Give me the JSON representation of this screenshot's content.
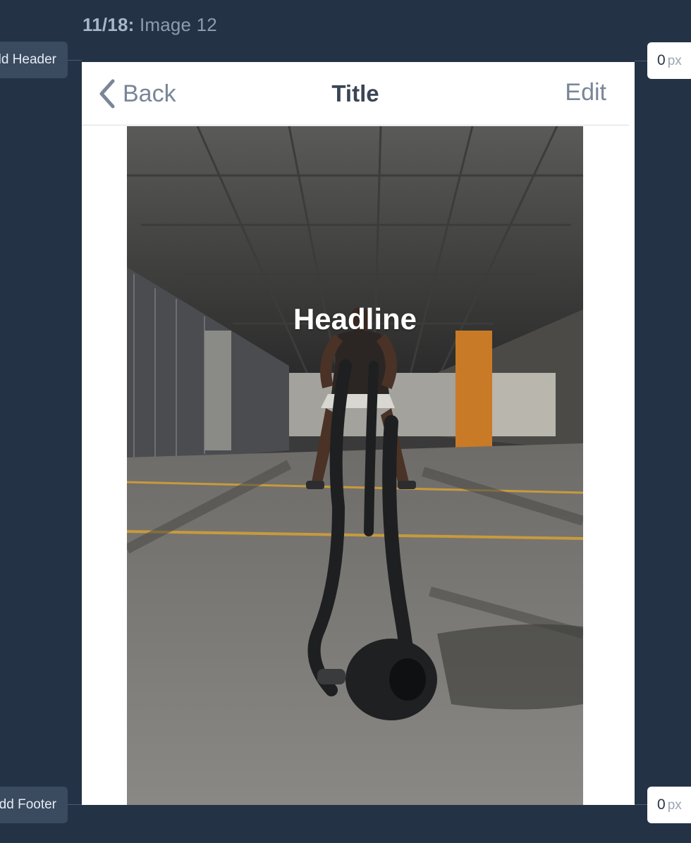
{
  "caption": {
    "count": "11/18:",
    "label": "Image 12"
  },
  "side_controls": {
    "header_label": "Add Header",
    "footer_label": "Add Footer",
    "header_px": {
      "value": "0",
      "unit": "px"
    },
    "footer_px": {
      "value": "0",
      "unit": "px"
    }
  },
  "nav": {
    "back_label": "Back",
    "title": "Title",
    "edit_label": "Edit"
  },
  "content": {
    "headline": "Headline"
  },
  "colors": {
    "background": "#243245",
    "accent_text": "#7a8697",
    "title_text": "#3a4554"
  }
}
